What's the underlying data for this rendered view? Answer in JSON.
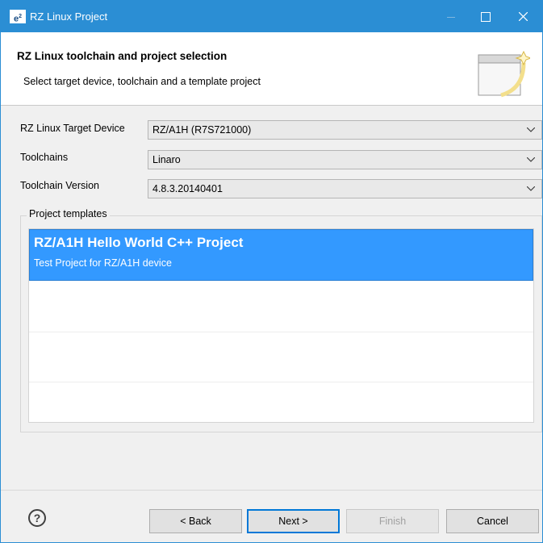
{
  "window": {
    "logo": "e²",
    "title": "RZ Linux Project"
  },
  "header": {
    "title": "RZ Linux toolchain and project selection",
    "subtitle": "Select target device, toolchain and a template project",
    "icon": "wizard-banner-icon"
  },
  "form": {
    "target_device": {
      "label": "RZ Linux Target Device",
      "value": "RZ/A1H (R7S721000)"
    },
    "toolchains": {
      "label": "Toolchains",
      "value": "Linaro"
    },
    "toolchain_version": {
      "label": "Toolchain Version",
      "value": "4.8.3.20140401"
    }
  },
  "templates": {
    "group_label": "Project templates",
    "items": [
      {
        "title": "RZ/A1H Hello World C++ Project",
        "description": "Test Project for RZ/A1H device",
        "selected": true
      }
    ]
  },
  "buttons": {
    "help": "?",
    "back": "< Back",
    "next": "Next >",
    "finish": "Finish",
    "cancel": "Cancel"
  },
  "colors": {
    "titlebar": "#2b8ed4",
    "selection": "#3399ff",
    "default_button_border": "#0078d7"
  }
}
